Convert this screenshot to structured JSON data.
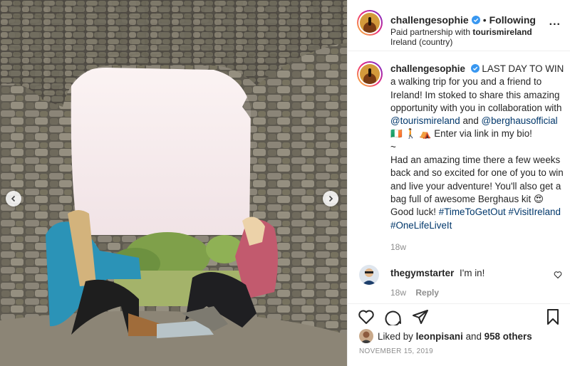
{
  "post": {
    "photo_alt": "Two women sitting inside a stone wall archway",
    "carousel": {
      "prev_icon": "chevron-left-icon",
      "next_icon": "chevron-right-icon"
    }
  },
  "header": {
    "username": "challengesophie",
    "separator": "•",
    "follow_status": "Following",
    "paid_partnership_prefix": "Paid partnership with",
    "partner": "tourismireland",
    "location": "Ireland (country)",
    "more": "..."
  },
  "caption": {
    "username": "challengesophie",
    "text1": "LAST DAY TO WIN a walking trip for you and a friend to Ireland! Im stoked to share this amazing opportunity with you in collaboration with",
    "mention1": "@tourismireland",
    "and": "and",
    "mention2": "@berghausofficial",
    "emoji_line": "🇮🇪 🚶 ⛺",
    "text2": "Enter via link in my bio!",
    "tilde": "~",
    "text3": "Had an amazing time there a few weeks back and so excited for one of you to win and live your adventure! You'll also get a bag full of awesome Berghaus kit",
    "emoji2": "😍",
    "text4": "Good luck!",
    "hashtag1": "#TimeToGetOut",
    "hashtag2": "#VisitIreland",
    "hashtag3": "#OneLifeLiveIt",
    "time": "18w"
  },
  "comment": {
    "username": "thegymstarter",
    "text": "I'm in!",
    "time": "18w",
    "reply": "Reply"
  },
  "likes": {
    "prefix": "Liked by",
    "user": "leonpisani",
    "and": "and",
    "others": "958 others"
  },
  "date": "NOVEMBER 15, 2019",
  "colors": {
    "link": "#00376b",
    "verified": "#3897f0",
    "muted": "#8e8e8e"
  }
}
